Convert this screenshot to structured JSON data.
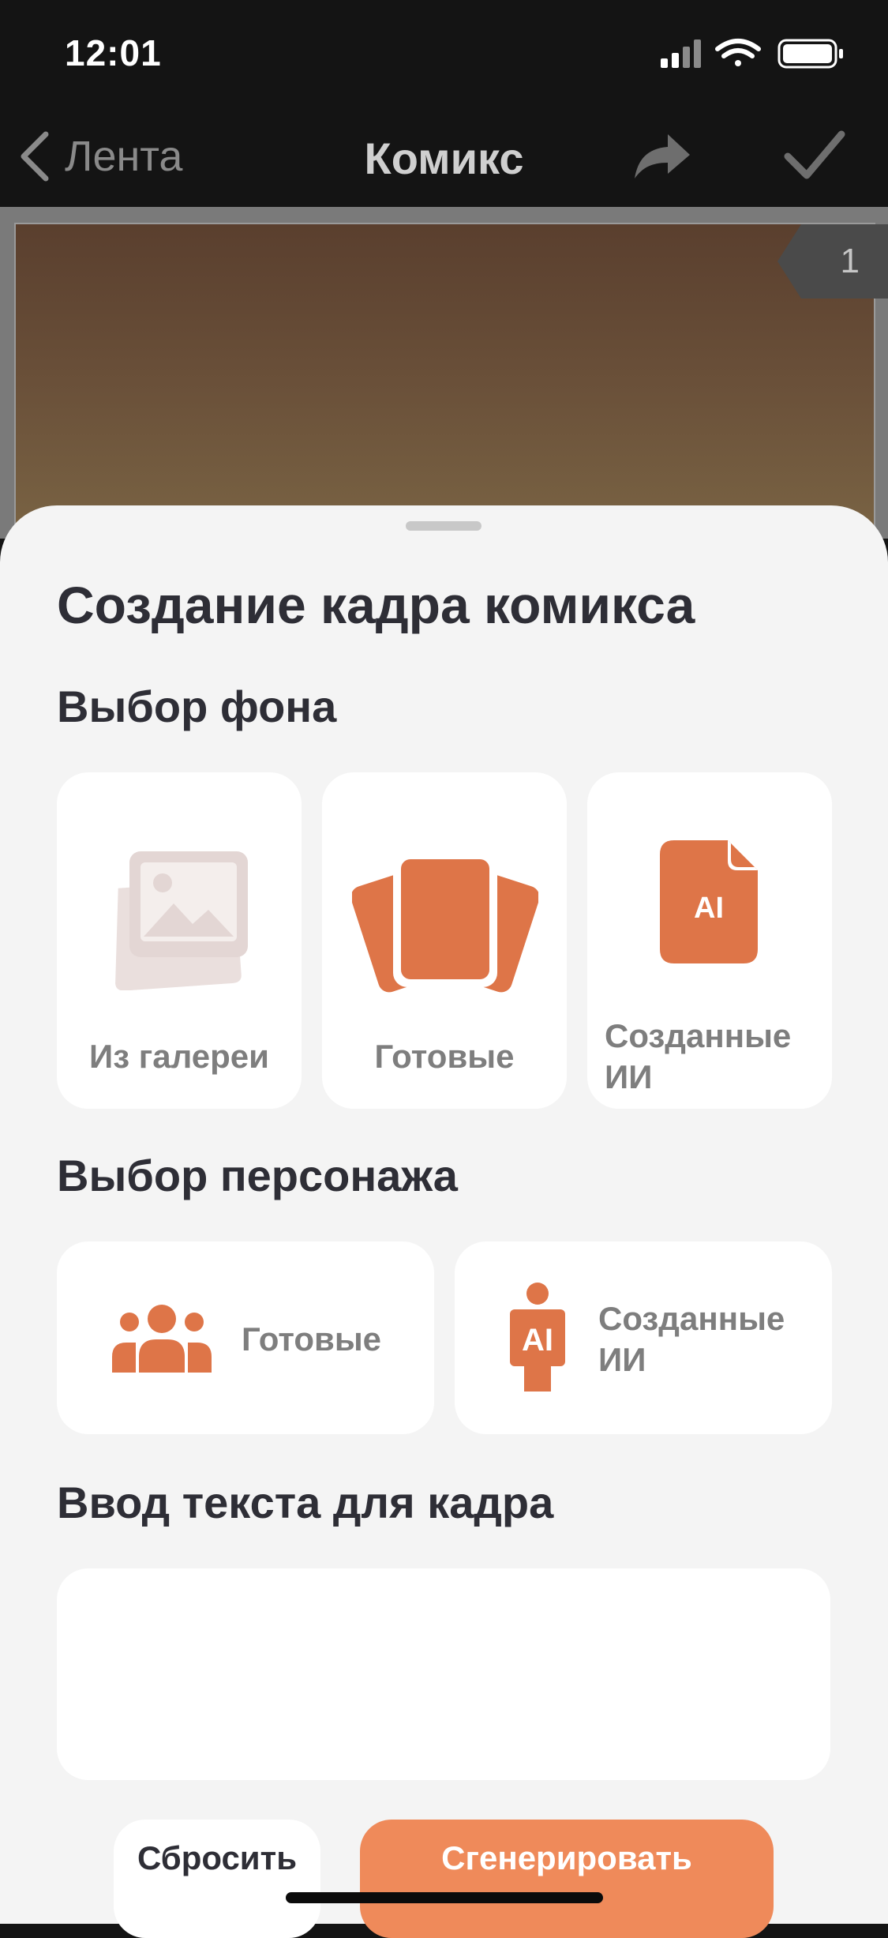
{
  "status_bar": {
    "time": "12:01",
    "icons": [
      "cellular-signal-icon",
      "wifi-icon",
      "battery-icon"
    ]
  },
  "nav": {
    "back_label": "Лента",
    "title": "Комикс",
    "share_icon": "share-arrow-icon",
    "done_icon": "checkmark-icon"
  },
  "canvas": {
    "frame_number": "1"
  },
  "sheet": {
    "title": "Создание кадра комикса",
    "background_section": {
      "title": "Выбор фона",
      "options": [
        {
          "label": "Из галереи",
          "icon": "gallery-icon"
        },
        {
          "label": "Готовые",
          "icon": "cards-icon"
        },
        {
          "label": "Созданные ИИ",
          "icon": "ai-file-icon"
        }
      ]
    },
    "character_section": {
      "title": "Выбор персонажа",
      "options": [
        {
          "label": "Готовые",
          "icon": "group-icon"
        },
        {
          "label": "Созданные ИИ",
          "icon": "ai-person-icon"
        }
      ]
    },
    "text_section": {
      "title": "Ввод текста для кадра",
      "value": ""
    },
    "buttons": {
      "reset": "Сбросить",
      "generate": "Сгенерировать"
    }
  },
  "colors": {
    "accent": "#DE7548",
    "button_primary": "#EF8A5A",
    "sheet_background": "#F4F4F4",
    "text_dark": "#2E2E36",
    "text_muted": "#7E7E7E"
  }
}
